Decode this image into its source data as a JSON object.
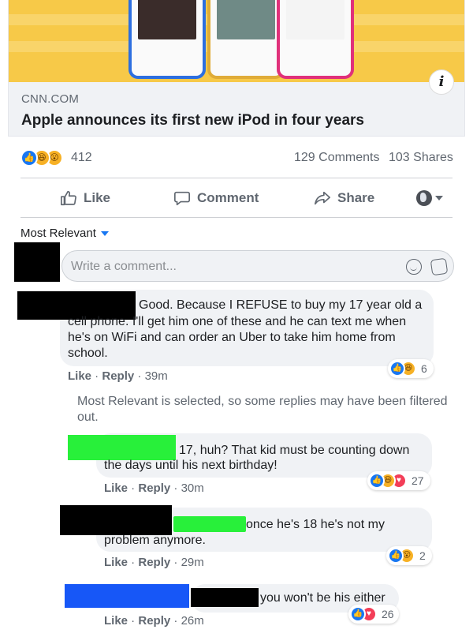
{
  "link_preview": {
    "domain": "CNN.COM",
    "title": "Apple announces its first new iPod in four years",
    "info_icon": "info-icon"
  },
  "reactions": {
    "types": [
      "like",
      "haha",
      "wow"
    ],
    "count": "412",
    "comments": "129 Comments",
    "shares": "103 Shares"
  },
  "actions": {
    "like": "Like",
    "comment": "Comment",
    "share": "Share"
  },
  "sort": {
    "label": "Most Relevant"
  },
  "composer": {
    "placeholder": "Write a comment..."
  },
  "comments": [
    {
      "text": "Good. Because I REFUSE to buy my 17 year old a cell phone. I'll get him one of these and he can text me when he's on WiFi and can order an Uber to take him home from school.",
      "line1": "Good. Because I REFUSE to buy my 17 year old a",
      "line2": "cell phone. I'll get him one of these and he can text me when",
      "line3": "he's on WiFi and can order an Uber to take him home from",
      "line4": "school.",
      "like": "Like",
      "reply": "Reply",
      "time": "39m",
      "reaction_types": [
        "like",
        "haha"
      ],
      "reaction_count": "6"
    }
  ],
  "filtered_note": "Most Relevant is selected, so some replies may have been filtered out.",
  "replies": [
    {
      "line1": "17, huh? That kid must be counting down",
      "line2": "the days until his next birthday!",
      "like": "Like",
      "reply": "Reply",
      "time": "30m",
      "reaction_types": [
        "like",
        "haha",
        "love"
      ],
      "reaction_count": "27"
    },
    {
      "line1": "once he's 18 he's not my",
      "line2": "problem anymore.",
      "like": "Like",
      "reply": "Reply",
      "time": "29m",
      "reaction_types": [
        "like",
        "wow"
      ],
      "reaction_count": "2"
    },
    {
      "line1": "you won't be his either",
      "like": "Like",
      "reply": "Reply",
      "time": "26m",
      "reaction_types": [
        "like",
        "love"
      ],
      "reaction_count": "26"
    }
  ],
  "colors": {
    "accent": "#1877f2",
    "bubble": "#f0f2f5",
    "preview_bg": "#f7c948",
    "redaction_green": "#28f03a",
    "redaction_blue": "#1757f7"
  }
}
